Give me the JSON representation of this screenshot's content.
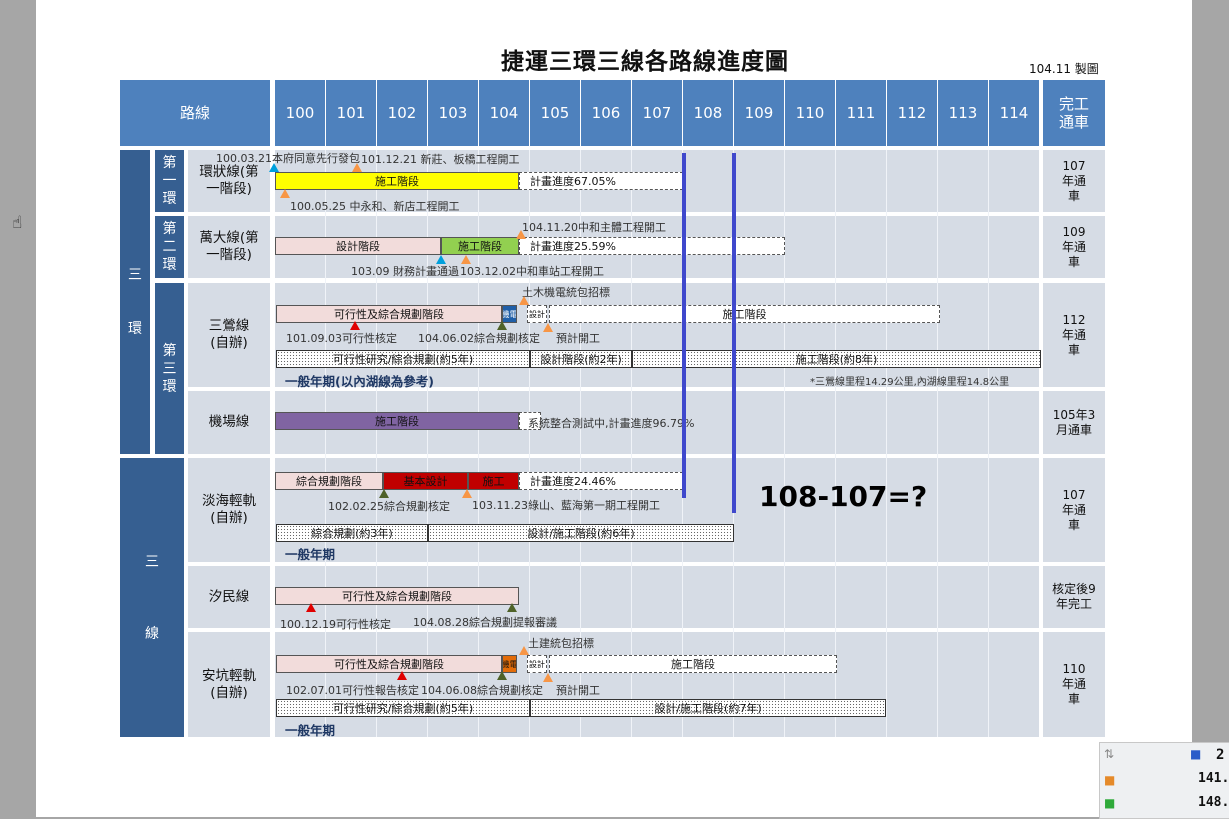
{
  "title": "捷運三環三線各路線進度圖",
  "date": "104.11 製圖",
  "header": {
    "route": "路線",
    "years": [
      "100",
      "101",
      "102",
      "103",
      "104",
      "105",
      "106",
      "107",
      "108",
      "109",
      "110",
      "111",
      "112",
      "113",
      "114"
    ],
    "completion": "完工通車"
  },
  "groups": {
    "three_rings": "三環",
    "three_lines_a": "三",
    "three_lines_b": "線",
    "ring1": "第一環",
    "ring2": "第二環",
    "ring3": "第三環"
  },
  "rows": {
    "circular": {
      "label": "環狀線(第一階段)",
      "completion": "107年通車",
      "bar1": "施工階段",
      "progress": "計畫進度67.05%",
      "note1": "100.03.21本府同意先行發包",
      "note2": "101.12.21 新莊、板橋工程開工",
      "note3": "100.05.25 中永和、新店工程開工"
    },
    "wanda": {
      "label": "萬大線(第一階段)",
      "completion": "109年通車",
      "bar1": "設計階段",
      "bar2": "施工階段",
      "progress": "計畫進度25.59%",
      "note1": "104.11.20中和主體工程開工",
      "note2": "103.09 財務計畫通過",
      "note3": "103.12.02中和車站工程開工"
    },
    "sanying": {
      "label": "三鶯線(自辦)",
      "completion": "112年通車",
      "bar1": "可行性及綜合規劃階段",
      "bar2": "機電",
      "bar3": "設計",
      "bar4": "施工階段",
      "note1": "土木機電統包招標",
      "note2": "101.09.03可行性核定",
      "note3": "104.06.02綜合規劃核定",
      "note4": "預計開工",
      "gen1": "可行性研究/綜合規劃(約5年)",
      "gen2": "設計階段(約2年)",
      "gen3": "施工階段(約8年)",
      "gen_label": "一般年期(以內湖線為參考)",
      "footnote": "*三鶯線里程14.29公里,內湖線里程14.8公里"
    },
    "airport": {
      "label": "機場線",
      "completion": "105年3月通車",
      "bar1": "施工階段",
      "progress": "系統整合測試中,計畫進度96.79%"
    },
    "danhai": {
      "label": "淡海輕軌(自辦)",
      "completion": "107年通車",
      "bar1": "綜合規劃階段",
      "bar2": "基本設計",
      "bar3": "施工",
      "progress": "計畫進度24.46%",
      "note1": "102.02.25綜合規劃核定",
      "note2": "103.11.23綠山、藍海第一期工程開工",
      "gen1": "綜合規劃(約3年)",
      "gen2": "設計/施工階段(約6年)",
      "gen_label": "一般年期"
    },
    "ximin": {
      "label": "汐民線",
      "completion": "核定後9年完工",
      "bar1": "可行性及綜合規劃階段",
      "note1": "100.12.19可行性核定",
      "note2": "104.08.28綜合規劃提報審議"
    },
    "ankeng": {
      "label": "安坑輕軌(自辦)",
      "completion": "110年通車",
      "bar1": "可行性及綜合規劃階段",
      "bar2": "機電",
      "bar3": "設計",
      "bar4": "施工階段",
      "note1": "土建統包招標",
      "note2": "102.07.01可行性報告核定",
      "note3": "104.06.08綜合規劃核定",
      "note4": "預計開工",
      "gen1": "可行性研究/綜合規劃(約5年)",
      "gen2": "設計/施工階段(約7年)",
      "gen_label": "一般年期"
    }
  },
  "annotation": "108-107=?",
  "tray": {
    "v1": "2",
    "v2": "141.",
    "v3": "148."
  }
}
